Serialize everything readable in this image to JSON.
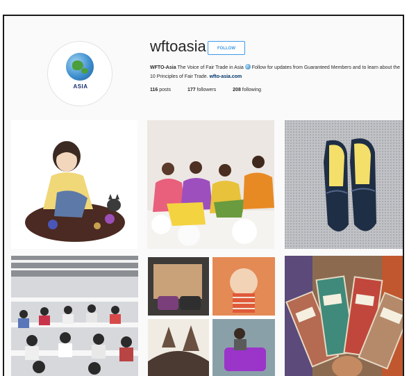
{
  "profile": {
    "username": "wftoasia",
    "follow_label": "FOLLOW",
    "avatar_text": "ASIA",
    "bio_name": "WFTO-Asia",
    "bio_text_1": "The Voice of Fair Trade in Asia",
    "bio_text_2": "Follow for updates from Guaranteed Members and to learn about the 10 Principles of Fair Trade.",
    "bio_link": "wfto-asia.com",
    "stats": [
      {
        "count": "116",
        "label": "posts"
      },
      {
        "count": "177",
        "label": "followers"
      },
      {
        "count": "208",
        "label": "following"
      }
    ]
  },
  "grid": {
    "posts": [
      {
        "subject": "illustration-girl-knitting"
      },
      {
        "subject": "women-cotton-harvest"
      },
      {
        "subject": "navy-loafers-on-knit"
      },
      {
        "subject": "garment-factory"
      },
      {
        "subject": "craft-collage"
      },
      {
        "subject": "hand-holding-cards"
      }
    ]
  },
  "colors": {
    "accent": "#3d9ae8",
    "border": "#1a1a1a",
    "background": "#fafafa",
    "link": "#003569"
  }
}
